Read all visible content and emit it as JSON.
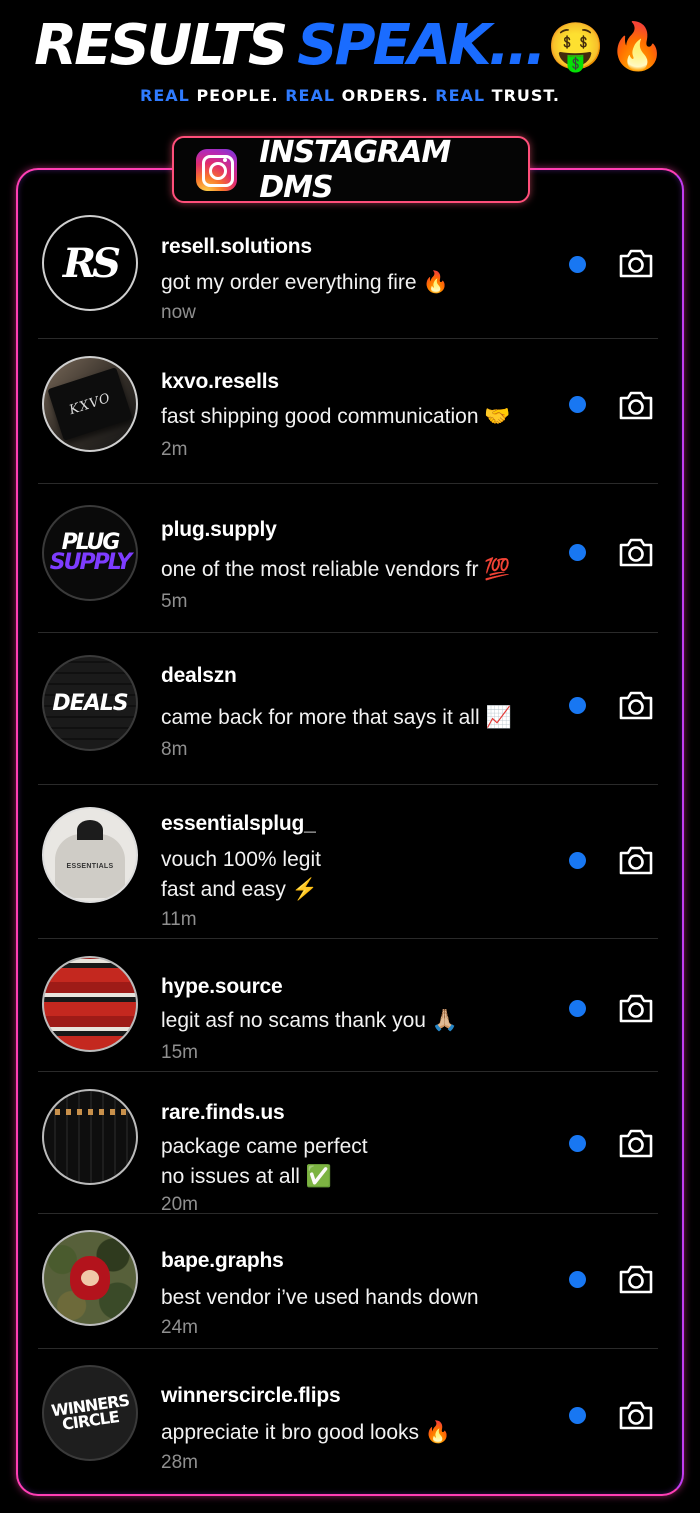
{
  "headline": {
    "word1": "RESULTS",
    "word2": "SPEAK...",
    "emoji1": "🤑",
    "emoji2": "🔥"
  },
  "subline": {
    "parts": [
      "REAL",
      "PEOPLE.",
      "REAL",
      "ORDERS.",
      "REAL",
      "TRUST."
    ]
  },
  "colors": {
    "accent_blue": "#1a6cff",
    "panel_border": "#ff3fb4",
    "unread_dot": "#1877f2",
    "timestamp": "#8f8f8f"
  },
  "header": {
    "icon": "instagram-logo-icon",
    "title": "INSTAGRAM DMS"
  },
  "messages": [
    {
      "username": "resell.solutions",
      "lines": [
        "got my order everything fire 🔥"
      ],
      "time": "now",
      "avatar_text": "RS",
      "unread": true,
      "action_icon": "camera-icon"
    },
    {
      "username": "kxvo.resells",
      "lines": [
        "fast shipping good communication 🤝"
      ],
      "time": "2m",
      "avatar_text": "KXVO",
      "unread": true,
      "action_icon": "camera-icon"
    },
    {
      "username": "plug.supply",
      "lines": [
        "one of the most reliable vendors fr 💯"
      ],
      "time": "5m",
      "avatar_text": [
        "PLUG",
        "SUPPLY"
      ],
      "unread": true,
      "action_icon": "camera-icon"
    },
    {
      "username": "dealszn",
      "lines": [
        "came back for more that says it all 📈"
      ],
      "time": "8m",
      "avatar_text": "DEALS",
      "unread": true,
      "action_icon": "camera-icon"
    },
    {
      "username": "essentialsplug_",
      "lines": [
        "vouch 100% legit",
        "fast and easy ⚡"
      ],
      "time": "11m",
      "avatar_text": "ESSENTIALS",
      "unread": true,
      "action_icon": "camera-icon"
    },
    {
      "username": "hype.source",
      "lines": [
        "legit asf no scams thank you 🙏🏼"
      ],
      "time": "15m",
      "unread": true,
      "action_icon": "camera-icon"
    },
    {
      "username": "rare.finds.us",
      "lines": [
        "package came perfect",
        "no issues at all ✅"
      ],
      "time": "20m",
      "unread": true,
      "action_icon": "camera-icon"
    },
    {
      "username": "bape.graphs",
      "lines": [
        "best vendor i’ve used hands down"
      ],
      "time": "24m",
      "unread": true,
      "action_icon": "camera-icon"
    },
    {
      "username": "winnerscircle.flips",
      "lines": [
        "appreciate it bro good looks 🔥"
      ],
      "time": "28m",
      "avatar_text": [
        "WINNERS",
        "CIRCLE"
      ],
      "unread": true,
      "action_icon": "camera-icon"
    }
  ]
}
